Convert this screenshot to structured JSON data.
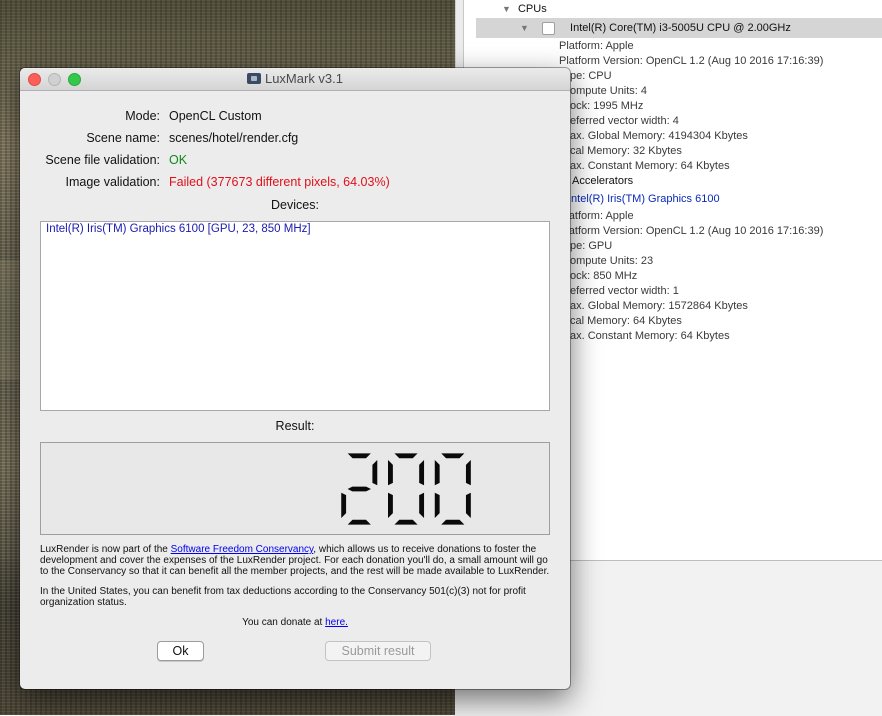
{
  "window": {
    "title": "LuxMark v3.1",
    "mode_label": "Mode:",
    "mode_value": "OpenCL Custom",
    "scene_label": "Scene name:",
    "scene_value": "scenes/hotel/render.cfg",
    "scene_validation_label": "Scene file validation:",
    "scene_validation_value": "OK",
    "image_validation_label": "Image validation:",
    "image_validation_value": "Failed (377673 different pixels, 64.03%)",
    "devices_title": "Devices:",
    "devices": [
      "Intel(R) Iris(TM) Graphics 6100 [GPU, 23, 850 MHz]"
    ],
    "result_title": "Result:",
    "result_value": "200",
    "info_p1_pre": "LuxRender is now part of the ",
    "info_p1_link": "Software Freedom Conservancy",
    "info_p1_post": ", which allows us to receive donations to foster the development and cover the expenses of the LuxRender project. For each donation you'll do, a small amount will go to the Conservancy so that it can benefit all the member projects, and the rest will be made available to LuxRender.",
    "info_p2": "In the United States, you can benefit from tax deductions according to the Conservancy 501(c)(3) not for profit organization status.",
    "donate_pre": "You can donate at ",
    "donate_link": "here.",
    "ok_label": "Ok",
    "submit_label": "Submit result"
  },
  "tree": {
    "cpus_header": "CPUs",
    "cpu_device": "Intel(R) Core(TM) i3-5005U CPU @ 2.00GHz",
    "cpu_props": [
      "Platform: Apple",
      "Platform Version: OpenCL 1.2 (Aug 10 2016 17:16:39)",
      "pe: CPU",
      "ompute Units: 4",
      "ock: 1995 MHz",
      "eferred vector width: 4",
      "ax. Global Memory: 4194304 Kbytes",
      "cal Memory: 32 Kbytes",
      "ax. Constant Memory: 64 Kbytes"
    ],
    "accel_header": "Accelerators",
    "gpu_device": "Intel(R) Iris(TM) Graphics 6100",
    "gpu_props": [
      "Platform: Apple",
      "Platform Version: OpenCL 1.2 (Aug 10 2016 17:16:39)",
      "pe: GPU",
      "ompute Units: 23",
      "ock: 850 MHz",
      "eferred vector width: 1",
      "ax. Global Memory: 1572864 Kbytes",
      "cal Memory: 64 Kbytes",
      "ax. Constant Memory: 64 Kbytes"
    ]
  },
  "colors": {
    "ok": "#0f8a17",
    "failed": "#e0101a",
    "device_text": "#1a1ab0",
    "close": "#fc5f57",
    "zoom": "#34c84a"
  },
  "icons": {
    "tree_expand": "disclosure-triangle-icon",
    "window_app": "luxmark-app-icon"
  }
}
